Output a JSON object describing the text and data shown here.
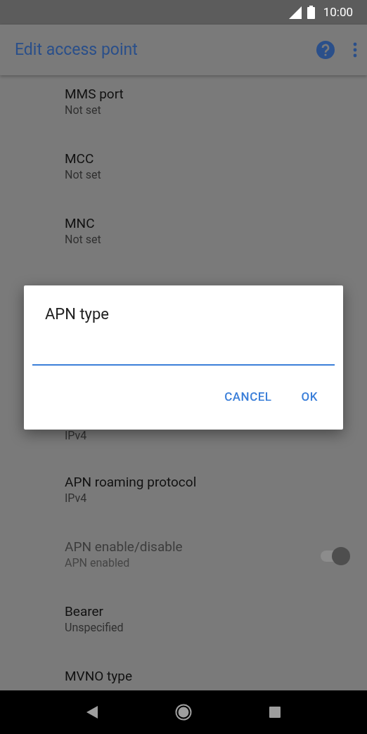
{
  "status_bar": {
    "time": "10:00"
  },
  "app_bar": {
    "title": "Edit access point"
  },
  "items": [
    {
      "title": "MMS port",
      "summary": "Not set",
      "enabled": true
    },
    {
      "title": "MCC",
      "summary": "Not set",
      "enabled": true
    },
    {
      "title": "MNC",
      "summary": "Not set",
      "enabled": true
    },
    {
      "summary": "IPv4",
      "enabled": true
    },
    {
      "title": "APN roaming protocol",
      "summary": "IPv4",
      "enabled": true
    },
    {
      "title": "APN enable/disable",
      "summary": "APN enabled",
      "enabled": false,
      "toggle": {
        "on": true
      }
    },
    {
      "title": "Bearer",
      "summary": "Unspecified",
      "enabled": true
    },
    {
      "title": "MVNO type",
      "enabled": true
    }
  ],
  "dialog": {
    "title": "APN type",
    "buttons": [
      "CANCEL",
      "OK"
    ]
  }
}
